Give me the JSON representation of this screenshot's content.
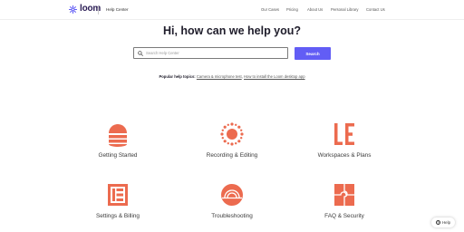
{
  "header": {
    "logo_text": "loom",
    "help_center": "Help Center",
    "nav": [
      "Our Cases",
      "Pricing",
      "About Us",
      "Personal Library",
      "Contact Us"
    ]
  },
  "hero": {
    "title": "Hi, how can we help you?",
    "search_placeholder": "Search Help Center",
    "search_button": "Search"
  },
  "popular": {
    "label": "Popular help topics:",
    "links": [
      "Camera & microphone test",
      "How to install the Loom desktop app"
    ]
  },
  "categories": [
    {
      "label": "Getting Started",
      "icon": "stacked-dome-icon"
    },
    {
      "label": "Recording & Editing",
      "icon": "sunburst-icon"
    },
    {
      "label": "Workspaces & Plans",
      "icon": "le-letters-icon"
    },
    {
      "label": "Settings & Billing",
      "icon": "frame-bars-icon"
    },
    {
      "label": "Troubleshooting",
      "icon": "rising-sun-icon"
    },
    {
      "label": "FAQ & Security",
      "icon": "puzzle-square-icon"
    }
  ],
  "help_button": {
    "label": "Help",
    "glyph": "?"
  },
  "colors": {
    "accent": "#625df5",
    "icon": "#ec6b4f",
    "brand": "#2b1d55"
  }
}
